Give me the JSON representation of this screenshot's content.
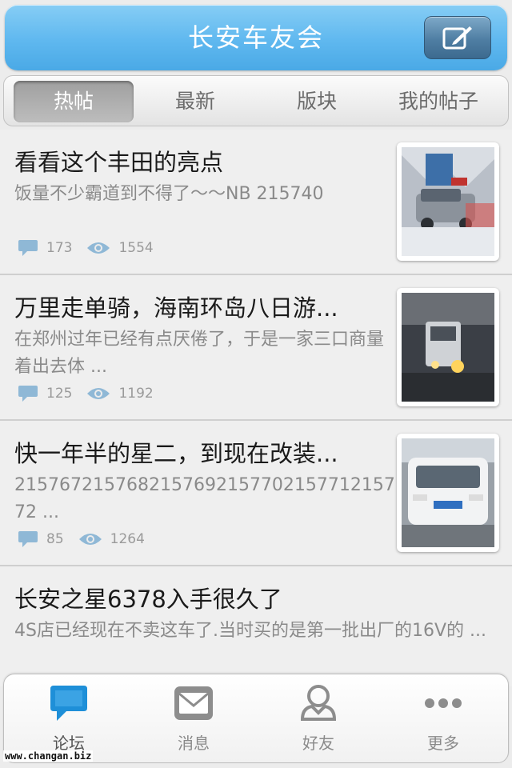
{
  "header": {
    "title": "长安车友会",
    "compose_icon": "compose-icon"
  },
  "tabs": [
    {
      "label": "热帖",
      "active": true
    },
    {
      "label": "最新",
      "active": false
    },
    {
      "label": "版块",
      "active": false
    },
    {
      "label": "我的帖子",
      "active": false
    }
  ],
  "posts": [
    {
      "title": "看看这个丰田的亮点",
      "excerpt": "饭量不少霸道到不得了～～NB 215740",
      "comments": "173",
      "views": "1554"
    },
    {
      "title": "万里走单骑，海南环岛八日游...",
      "excerpt": "在郑州过年已经有点厌倦了，于是一家三口商量着出去体 ...",
      "comments": "125",
      "views": "1192"
    },
    {
      "title": "快一年半的星二，到现在改装...",
      "excerpt": "215767215768215769215770215771215772 ...",
      "comments": "85",
      "views": "1264"
    },
    {
      "title": "长安之星6378入手很久了",
      "excerpt": "4S店已经现在不卖这车了.当时买的是第一批出厂的16V的 ..."
    }
  ],
  "bottom_nav": [
    {
      "label": "论坛",
      "icon": "forum-chat-icon",
      "active": true
    },
    {
      "label": "消息",
      "icon": "envelope-icon",
      "active": false
    },
    {
      "label": "好友",
      "icon": "person-icon",
      "active": false
    },
    {
      "label": "更多",
      "icon": "more-dots-icon",
      "active": false
    }
  ],
  "watermark": "www.changan.biz",
  "colors": {
    "header_blue": "#5fb8ef",
    "accent_blue": "#1e8fd8",
    "stat_icon": "#8fb8d6"
  }
}
